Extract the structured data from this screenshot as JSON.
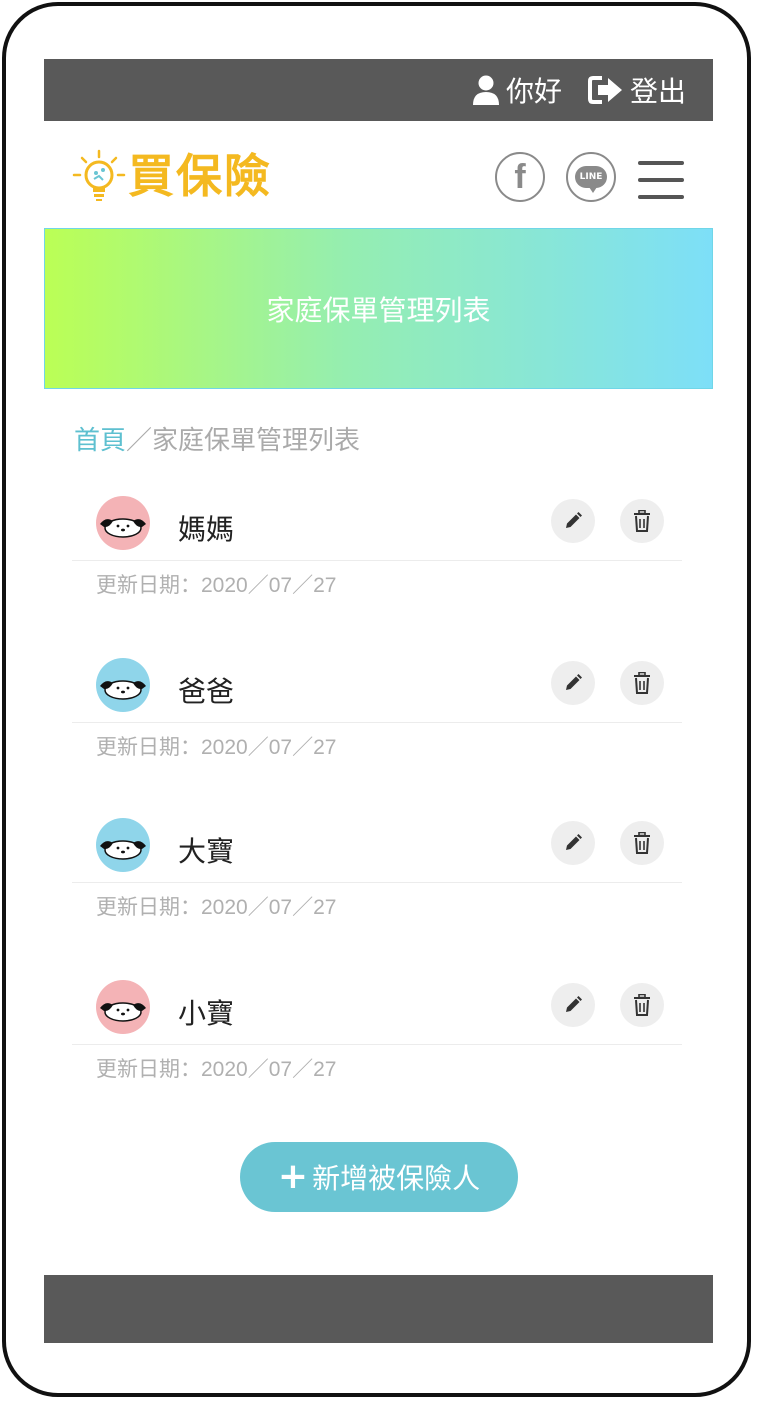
{
  "topbar": {
    "greeting": "你好",
    "logout": "登出"
  },
  "header": {
    "logo_text": "買保險",
    "facebook_glyph": "f",
    "line_label": "LINE"
  },
  "banner": {
    "title": "家庭保單管理列表"
  },
  "breadcrumb": {
    "home": "首頁",
    "separator": "／",
    "current": "家庭保單管理列表"
  },
  "members": [
    {
      "name": "媽媽",
      "updated": "更新日期：2020／07／27",
      "avatar_color": "#f4b3b6"
    },
    {
      "name": "爸爸",
      "updated": "更新日期：2020／07／27",
      "avatar_color": "#8fd5ea"
    },
    {
      "name": "大寶",
      "updated": "更新日期：2020／07／27",
      "avatar_color": "#8fd5ea"
    },
    {
      "name": "小寶",
      "updated": "更新日期：2020／07／27",
      "avatar_color": "#f4b3b6"
    }
  ],
  "actions": {
    "add_label": "新增被保險人"
  },
  "colors": {
    "topbar": "#595959",
    "accent": "#6ac5d3",
    "logo": "#f4b920",
    "link": "#5ec0d0"
  }
}
